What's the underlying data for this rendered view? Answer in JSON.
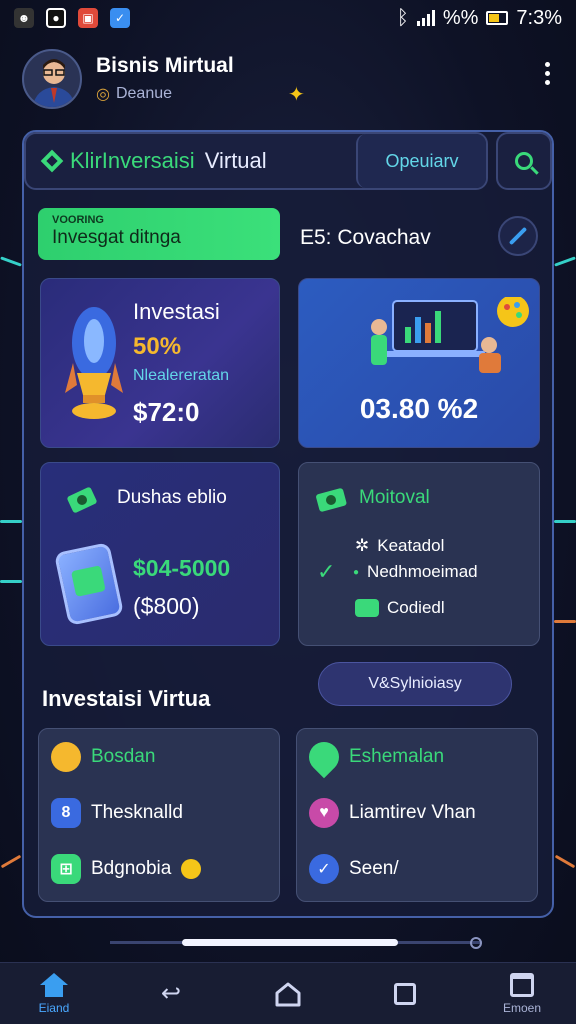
{
  "status_bar": {
    "time": "7:3%",
    "percent": "%%",
    "left_icons": [
      "app-icon-1",
      "app-icon-2",
      "app-icon-3",
      "app-icon-4"
    ],
    "battery_level": 0.55
  },
  "header": {
    "title": "Bisnis Mirtual",
    "subtitle": "Deanue"
  },
  "topbar": {
    "title_green": "KlirInversaisi",
    "title_white": "Virtual",
    "tab_label": "Opeuiarv"
  },
  "quick": {
    "badge_small": "VOORING",
    "badge_big": "Invesgat ditnga",
    "section_label": "E5: Covachav"
  },
  "card_invest": {
    "title": "Investasi",
    "percent": "50%",
    "subtitle": "Nlealereratan",
    "amount": "$72:0"
  },
  "card_stats": {
    "value": "03.80 %2"
  },
  "card_balance": {
    "title": "Dushas eblio",
    "amount": "$04-5000",
    "sub": "($800)"
  },
  "card_motivation": {
    "title": "Moitoval",
    "items": [
      "Keatadol",
      "Nedhmoeimad",
      "Codiedl"
    ]
  },
  "section2": {
    "title": "Investaisi Virtua",
    "button": "V&Sylnioiasy"
  },
  "list_left": {
    "items": [
      "Bosdan",
      "Thesknalld",
      "Bdgnobia"
    ]
  },
  "list_right": {
    "items": [
      "Eshemalan",
      "Liamtirev Vhan",
      "Seen/"
    ]
  },
  "progress": {
    "value": 0.58
  },
  "navbar": {
    "home_label": "Eiand",
    "right_label": "Emoen"
  },
  "colors": {
    "accent_green": "#3ad97a",
    "accent_blue": "#3a9ef0",
    "gold": "#f5b82e",
    "panel_border": "#4560a8"
  }
}
